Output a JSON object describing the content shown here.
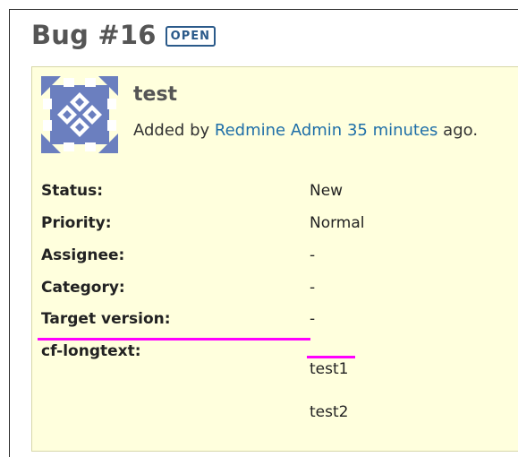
{
  "issue": {
    "title": "Bug #16",
    "status_badge": "OPEN",
    "subject": "test",
    "added_by_prefix": "Added by",
    "author": "Redmine Admin",
    "time_ago": "35 minutes",
    "suffix": "ago."
  },
  "attributes": [
    {
      "label": "Status:",
      "value": "New"
    },
    {
      "label": "Priority:",
      "value": "Normal"
    },
    {
      "label": "Assignee:",
      "value": "-"
    },
    {
      "label": "Category:",
      "value": "-"
    },
    {
      "label": "Target version:",
      "value": "-"
    },
    {
      "label": "cf-longtext:",
      "value": ""
    }
  ],
  "custom_field": {
    "line1": "test1",
    "line2": "test2"
  },
  "colors": {
    "badge": "#2b5a8a",
    "link": "#1f6fa8",
    "box_bg": "#ffffdd",
    "highlight": "#ff00ff"
  }
}
